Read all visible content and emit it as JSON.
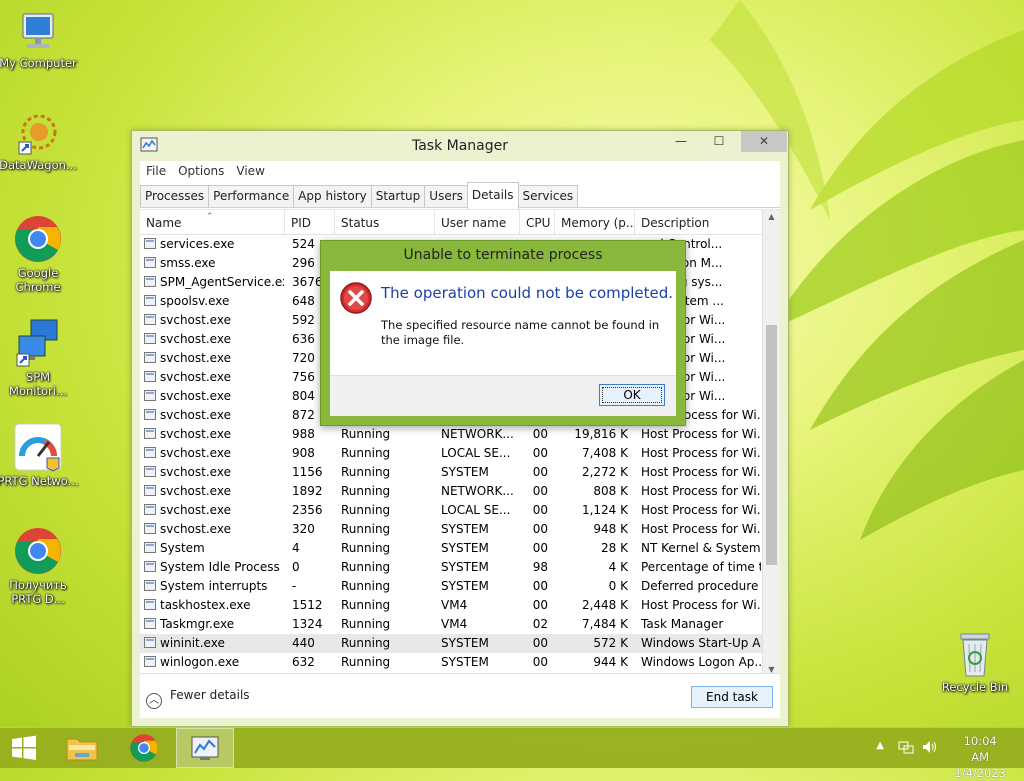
{
  "desktop": {
    "icons": [
      {
        "label": "My Computer"
      },
      {
        "label": "DataWagon..."
      },
      {
        "label": "Google Chrome"
      },
      {
        "label": "SPM Monitori..."
      },
      {
        "label": "PRTG Netwo..."
      },
      {
        "label": "Получить PRTG D..."
      },
      {
        "label": "Recycle Bin"
      }
    ]
  },
  "task_manager": {
    "title": "Task Manager",
    "window_buttons": {
      "minimize": "—",
      "maximize": "☐",
      "close": "✕"
    },
    "menu": [
      "File",
      "Options",
      "View"
    ],
    "tabs": [
      "Processes",
      "Performance",
      "App history",
      "Startup",
      "Users",
      "Details",
      "Services"
    ],
    "active_tab": "Details",
    "columns": [
      "Name",
      "PID",
      "Status",
      "User name",
      "CPU",
      "Memory (p...",
      "Description"
    ],
    "rows": [
      {
        "name": "services.exe",
        "pid": "524",
        "status": "",
        "user": "",
        "cpu": "",
        "mem": "",
        "desc": "and Control..."
      },
      {
        "name": "smss.exe",
        "pid": "296",
        "status": "",
        "user": "",
        "cpu": "",
        "mem": "",
        "desc": "s Session M..."
      },
      {
        "name": "SPM_AgentService.exe",
        "pid": "3676",
        "status": "",
        "user": "",
        "cpu": "",
        "mem": "",
        "desc": "nitoring sys..."
      },
      {
        "name": "spoolsv.exe",
        "pid": "648",
        "status": "",
        "user": "",
        "cpu": "",
        "mem": "",
        "desc": "SubSystem ..."
      },
      {
        "name": "svchost.exe",
        "pid": "592",
        "status": "",
        "user": "",
        "cpu": "",
        "mem": "",
        "desc": "ocess for Wi..."
      },
      {
        "name": "svchost.exe",
        "pid": "636",
        "status": "",
        "user": "",
        "cpu": "",
        "mem": "",
        "desc": "ocess for Wi..."
      },
      {
        "name": "svchost.exe",
        "pid": "720",
        "status": "",
        "user": "",
        "cpu": "",
        "mem": "",
        "desc": "ocess for Wi..."
      },
      {
        "name": "svchost.exe",
        "pid": "756",
        "status": "",
        "user": "",
        "cpu": "",
        "mem": "",
        "desc": "ocess for Wi..."
      },
      {
        "name": "svchost.exe",
        "pid": "804",
        "status": "",
        "user": "",
        "cpu": "",
        "mem": "",
        "desc": "ocess for Wi..."
      },
      {
        "name": "svchost.exe",
        "pid": "872",
        "status": "Running",
        "user": "SYSTEM",
        "cpu": "",
        "mem": "",
        "desc": "Host Process for Wi..."
      },
      {
        "name": "svchost.exe",
        "pid": "988",
        "status": "Running",
        "user": "NETWORK...",
        "cpu": "00",
        "mem": "19,816 K",
        "desc": "Host Process for Wi..."
      },
      {
        "name": "svchost.exe",
        "pid": "908",
        "status": "Running",
        "user": "LOCAL SE...",
        "cpu": "00",
        "mem": "7,408 K",
        "desc": "Host Process for Wi..."
      },
      {
        "name": "svchost.exe",
        "pid": "1156",
        "status": "Running",
        "user": "SYSTEM",
        "cpu": "00",
        "mem": "2,272 K",
        "desc": "Host Process for Wi..."
      },
      {
        "name": "svchost.exe",
        "pid": "1892",
        "status": "Running",
        "user": "NETWORK...",
        "cpu": "00",
        "mem": "808 K",
        "desc": "Host Process for Wi..."
      },
      {
        "name": "svchost.exe",
        "pid": "2356",
        "status": "Running",
        "user": "LOCAL SE...",
        "cpu": "00",
        "mem": "1,124 K",
        "desc": "Host Process for Wi..."
      },
      {
        "name": "svchost.exe",
        "pid": "320",
        "status": "Running",
        "user": "SYSTEM",
        "cpu": "00",
        "mem": "948 K",
        "desc": "Host Process for Wi..."
      },
      {
        "name": "System",
        "pid": "4",
        "status": "Running",
        "user": "SYSTEM",
        "cpu": "00",
        "mem": "28 K",
        "desc": "NT Kernel & System"
      },
      {
        "name": "System Idle Process",
        "pid": "0",
        "status": "Running",
        "user": "SYSTEM",
        "cpu": "98",
        "mem": "4 K",
        "desc": "Percentage of time t..."
      },
      {
        "name": "System interrupts",
        "pid": "-",
        "status": "Running",
        "user": "SYSTEM",
        "cpu": "00",
        "mem": "0 K",
        "desc": "Deferred procedure ..."
      },
      {
        "name": "taskhostex.exe",
        "pid": "1512",
        "status": "Running",
        "user": "VM4",
        "cpu": "00",
        "mem": "2,448 K",
        "desc": "Host Process for Wi..."
      },
      {
        "name": "Taskmgr.exe",
        "pid": "1324",
        "status": "Running",
        "user": "VM4",
        "cpu": "02",
        "mem": "7,484 K",
        "desc": "Task Manager"
      },
      {
        "name": "wininit.exe",
        "pid": "440",
        "status": "Running",
        "user": "SYSTEM",
        "cpu": "00",
        "mem": "572 K",
        "desc": "Windows Start-Up A..."
      },
      {
        "name": "winlogon.exe",
        "pid": "632",
        "status": "Running",
        "user": "SYSTEM",
        "cpu": "00",
        "mem": "944 K",
        "desc": "Windows Logon Ap..."
      }
    ],
    "selected_row": 21,
    "fewer_details": "Fewer details",
    "end_task": "End task"
  },
  "dialog": {
    "title": "Unable to terminate process",
    "main_instruction": "The operation could not be completed.",
    "content": "The specified resource name cannot be found in the image file.",
    "ok_label": "OK",
    "icon": "error-icon"
  },
  "taskbar": {
    "clock_time": "10:04 AM",
    "clock_date": "1/4/2023",
    "items": [
      "start-button",
      "file-explorer",
      "google-chrome",
      "task-manager"
    ]
  },
  "colors": {
    "accent": "#8ab83c",
    "dialog_heading": "#1b3fa8",
    "taskbar": "#96af1e"
  }
}
